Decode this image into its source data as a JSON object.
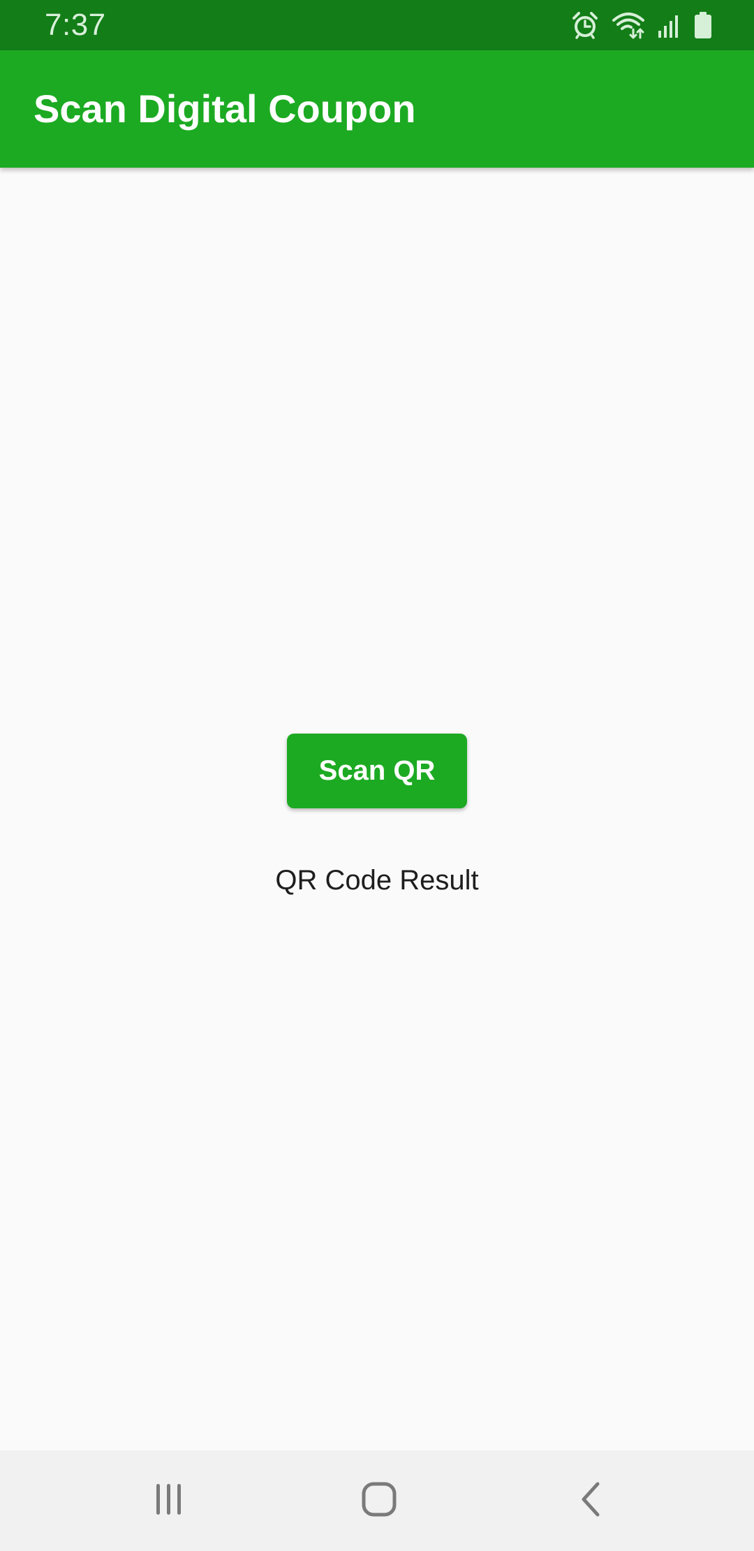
{
  "status_bar": {
    "time": "7:37",
    "icons": [
      "alarm-icon",
      "wifi-icon",
      "signal-icon",
      "battery-icon"
    ]
  },
  "app_bar": {
    "title": "Scan Digital Coupon"
  },
  "main": {
    "scan_button_label": "Scan QR",
    "result_text": "QR Code Result"
  },
  "nav_bar": {
    "buttons": [
      "recents-icon",
      "home-icon",
      "back-icon"
    ]
  },
  "colors": {
    "status_bar": "#137d18",
    "app_bar": "#1caa22",
    "button": "#1caa22",
    "background": "#fafafa",
    "nav_bar": "#f1f1f1"
  }
}
